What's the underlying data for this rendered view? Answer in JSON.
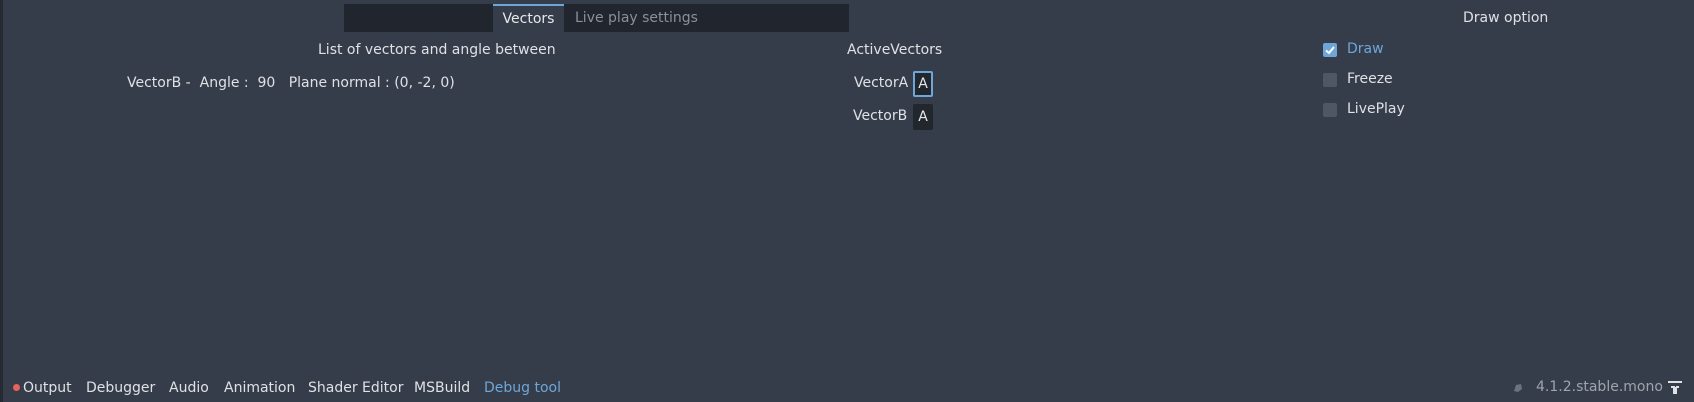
{
  "tabs": [
    {
      "label": "Vectors",
      "active": true
    },
    {
      "label": "Live play settings",
      "active": false
    }
  ],
  "list_section": {
    "title": "List of vectors and angle between",
    "rows": [
      "VectorB -  Angle :  90   Plane normal : (0, -2, 0)"
    ]
  },
  "active_vectors": {
    "title": "ActiveVectors",
    "items": [
      {
        "label": "VectorA",
        "value": "A",
        "focused": true
      },
      {
        "label": "VectorB",
        "value": "A",
        "focused": false
      }
    ]
  },
  "draw_option": {
    "title": "Draw option",
    "options": [
      {
        "label": "Draw",
        "checked": true
      },
      {
        "label": "Freeze",
        "checked": false
      },
      {
        "label": "LivePlay",
        "checked": false
      }
    ]
  },
  "bottom_tabs": [
    "Output",
    "Debugger",
    "Audio",
    "Animation",
    "Shader Editor",
    "MSBuild",
    "Debug tool"
  ],
  "active_bottom_tab": "Debug tool",
  "version": "4.1.2.stable.mono",
  "colors": {
    "accent": "#6ea6d8",
    "background": "#363d4a",
    "error_dot": "#e8615c"
  }
}
